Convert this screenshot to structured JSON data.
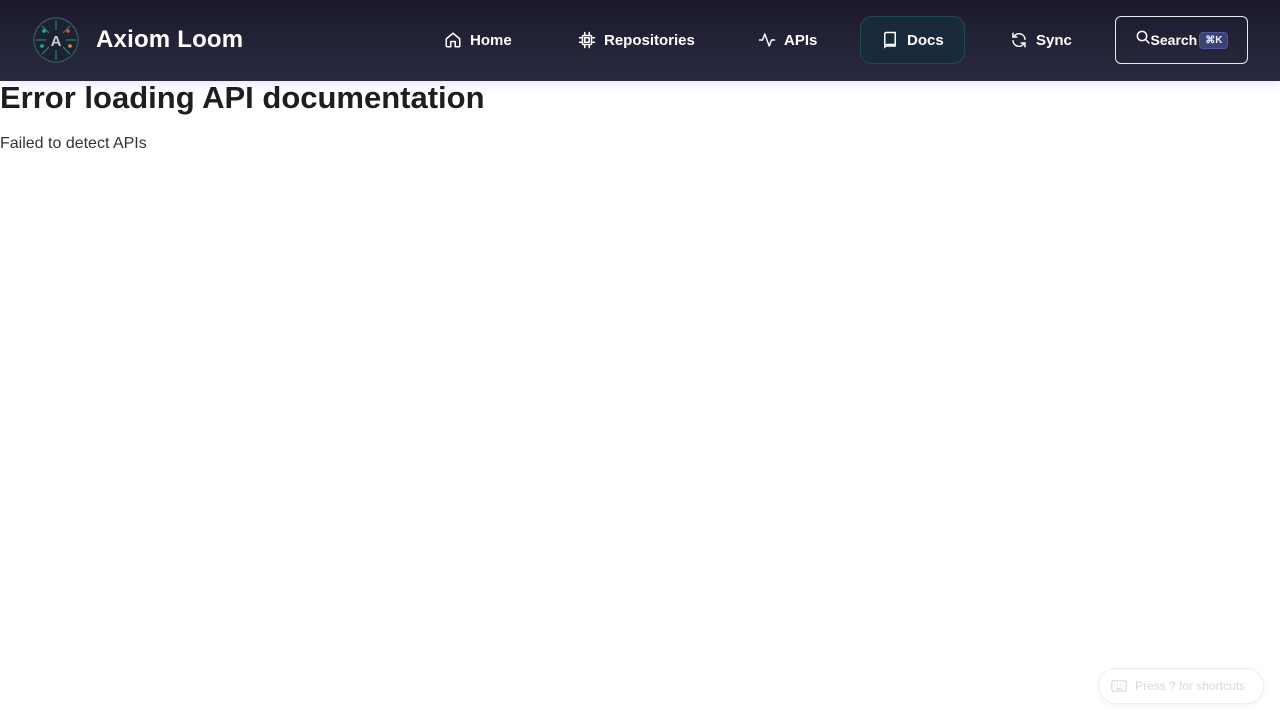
{
  "header": {
    "brand": "Axiom Loom",
    "nav": [
      {
        "label": "Home",
        "icon": "home-icon"
      },
      {
        "label": "Repositories",
        "icon": "cpu-chip-icon"
      },
      {
        "label": "APIs",
        "icon": "activity-pulse-icon"
      },
      {
        "label": "Docs",
        "icon": "book-icon",
        "active": true
      },
      {
        "label": "Sync",
        "icon": "refresh-icon"
      }
    ],
    "search": {
      "label": "Search",
      "shortcut": "⌘K",
      "icon": "search-icon"
    }
  },
  "main": {
    "title": "Error loading API documentation",
    "message": "Failed to detect APIs"
  },
  "shortcut_hint": {
    "label": "Press ? for shortcuts",
    "icon": "keyboard-icon"
  },
  "colors": {
    "nav_bg": "#1b1a2c",
    "active_nav_bg": "#1a2a3d",
    "kbd_bg": "#3b4170"
  }
}
